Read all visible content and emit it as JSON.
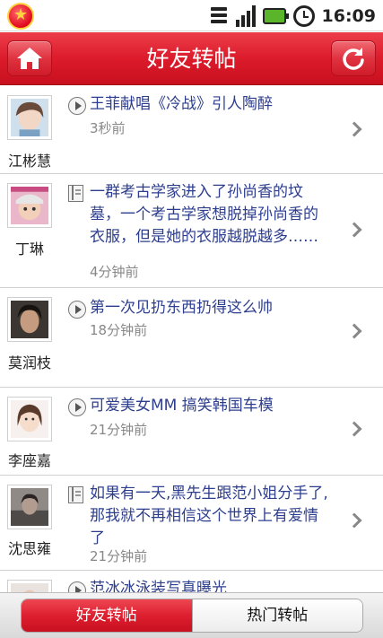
{
  "status_bar": {
    "time": "16:09"
  },
  "header": {
    "title": "好友转帖",
    "home_icon": "home-icon",
    "refresh_icon": "refresh-icon",
    "accent_color": "#dc1b2b"
  },
  "posts": [
    {
      "user": "江彬慧",
      "type": "video",
      "text": "王菲献唱《冷战》引人陶醉",
      "time": "3秒前"
    },
    {
      "user": "丁琳",
      "type": "article",
      "text": "一群考古学家进入了孙尚香的坟墓，一个考古学家想脱掉孙尚香的衣服，但是她的衣服越脱越多……",
      "time": "4分钟前"
    },
    {
      "user": "莫润枝",
      "type": "video",
      "text": "第一次见扔东西扔得这么帅",
      "time": "18分钟前"
    },
    {
      "user": "李座嘉",
      "type": "video",
      "text": "可爱美女MM 搞笑韩国车模",
      "time": "21分钟前"
    },
    {
      "user": "沈思雍",
      "type": "article",
      "text": "如果有一天,黑先生跟范小姐分手了,那我就不再相信这个世界上有爱情了",
      "time": "21分钟前"
    },
    {
      "user": "",
      "type": "video",
      "text": "范冰冰泳装写真曝光",
      "time": ""
    }
  ],
  "tabs": [
    {
      "label": "好友转帖",
      "active": true
    },
    {
      "label": "热门转帖",
      "active": false
    }
  ]
}
